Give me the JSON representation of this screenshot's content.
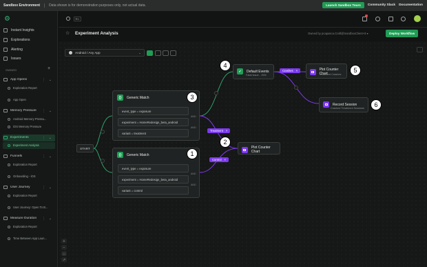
{
  "banner": {
    "environment": "Sandbox Environment",
    "note": "Data shown is for demonstration purposes only, not actual data.",
    "launch_button": "Launch Sandbox Tours",
    "community_link": "Community Slack",
    "docs_link": "Documentation"
  },
  "topbar": {
    "search_shortcut": "⌘K",
    "notification_count": "1"
  },
  "sidebar": {
    "nav": [
      {
        "label": "Instant Insights",
        "icon": "lightning-icon"
      },
      {
        "label": "Explorations",
        "icon": "compass-icon"
      },
      {
        "label": "Alerting",
        "icon": "bell-icon"
      },
      {
        "label": "Issues",
        "icon": "issue-icon"
      }
    ],
    "owned_label": "OWNED",
    "folders": [
      {
        "name": "App Opens",
        "items": [
          "Exploration Report",
          "App Open"
        ]
      },
      {
        "name": "Memory Pressure",
        "items": [
          "Android Memory Pressu...",
          "iOS Memory Pressure"
        ]
      },
      {
        "name": "Experiments",
        "items": [
          "Experiment Analysis"
        ]
      },
      {
        "name": "Funnels",
        "items": [
          "Exploration Report",
          "Onboarding - iOS"
        ]
      },
      {
        "name": "User Journey",
        "items": [
          "Exploration Report",
          "User Journey: Open To B..."
        ]
      },
      {
        "name": "Measure Duration",
        "items": [
          "Exploration Report",
          "Time Between App Laun..."
        ]
      }
    ]
  },
  "header": {
    "title": "Experiment Analysis",
    "owner": "Owned by pcapasca.Craft@SandboxClient+8  ▾",
    "deploy_button": "Deploy Workflow"
  },
  "filter": {
    "platform": "Android / Any App"
  },
  "canvas": {
    "start_label": "START",
    "match1": {
      "title": "Generic Match",
      "conditions": [
        "event_type = exposure",
        "experiment = HomeRedesign_beta_android",
        "variant = treatment"
      ],
      "and_label": "AND"
    },
    "match2": {
      "title": "Generic Match",
      "conditions": [
        "event_type = exposure",
        "experiment = HomeRedesign_beta_android",
        "variant = control"
      ],
      "and_label": "AND"
    },
    "default_events": {
      "title": "Default Events",
      "subtitle": "Fatal Issue - JVM"
    },
    "plot_top": {
      "title": "Plot Counter Chart",
      "subtitle": "Treatment Crashes"
    },
    "record_session": {
      "title": "Record Session",
      "subtitle": "Crashed Treatment Sessions"
    },
    "plot_bottom": {
      "title": "Plot Counter Chart"
    },
    "pills": {
      "treatment": "Treatment",
      "control": "Control",
      "crashes": "Crashes",
      "close": "×"
    },
    "callouts": [
      "1",
      "2",
      "3",
      "4",
      "5",
      "6"
    ],
    "zoom_controls": [
      "+",
      "−",
      "[ ]",
      "↗"
    ]
  },
  "colors": {
    "accent_green": "#1f9d55",
    "accent_purple": "#7c3aed",
    "edge_green": "#2fa36b",
    "edge_purple": "#7c3aed"
  }
}
